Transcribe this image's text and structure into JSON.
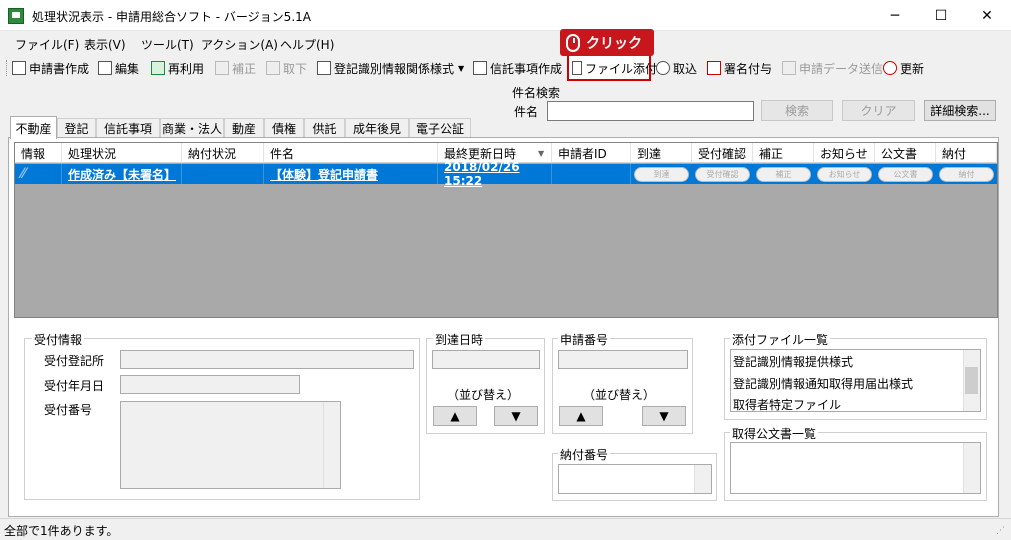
{
  "window": {
    "title": "処理状況表示 - 申請用総合ソフト - バージョン5.1A",
    "minimize": "─",
    "maximize": "☐",
    "close": "✕"
  },
  "menu": [
    "ファイル(F)",
    "表示(V)",
    "ツール(T)",
    "アクション(A)",
    "ヘルプ(H)"
  ],
  "toolbar": {
    "create_application": "申請書作成",
    "edit": "編集",
    "reuse": "再利用",
    "correct": "補正",
    "withdraw": "取下",
    "registration_form": "登記識別情報関係様式",
    "trust_matters": "信託事項作成",
    "file_attach": "ファイル添付",
    "import": "取込",
    "sign": "署名付与",
    "send_data": "申請データ送信",
    "refresh": "更新"
  },
  "callout": {
    "label": "クリック"
  },
  "search": {
    "group_label": "件名検索",
    "name_label": "件名",
    "value": "",
    "search_button": "検索",
    "clear_button": "クリア",
    "detail_button": "詳細検索..."
  },
  "tabs": [
    "不動産",
    "登記",
    "信託事項",
    "商業・法人",
    "動産",
    "債権",
    "供託",
    "成年後見",
    "電子公証"
  ],
  "grid": {
    "columns": [
      "情報",
      "処理状況",
      "納付状況",
      "件名",
      "最終更新日時",
      "申請者ID",
      "到達",
      "受付確認",
      "補正",
      "お知らせ",
      "公文書",
      "納付"
    ],
    "row": {
      "status": "作成済み【未署名】",
      "payment": "",
      "subject": "【体験】登記申請書",
      "updated": "2018/02/26 15:22",
      "applicant_id": "",
      "pills": [
        "到達",
        "受付確認",
        "補正",
        "お知らせ",
        "公文書",
        "納付"
      ]
    }
  },
  "reception": {
    "group_label": "受付情報",
    "office_label": "受付登記所",
    "date_label": "受付年月日",
    "number_label": "受付番号"
  },
  "arrival": {
    "group_label": "到達日時",
    "sort_label": "（並び替え）",
    "up": "▲",
    "down": "▼"
  },
  "application_number": {
    "group_label": "申請番号",
    "sort_label": "（並び替え）",
    "up": "▲",
    "down": "▼"
  },
  "payment_number": {
    "group_label": "納付番号"
  },
  "attachments": {
    "group_label": "添付ファイル一覧",
    "items": [
      "登記識別情報提供様式",
      "登記識別情報通知取得用届出様式",
      "取得者特定ファイル"
    ]
  },
  "official_docs": {
    "group_label": "取得公文書一覧"
  },
  "status_bar": {
    "text": "全部で1件あります。"
  }
}
